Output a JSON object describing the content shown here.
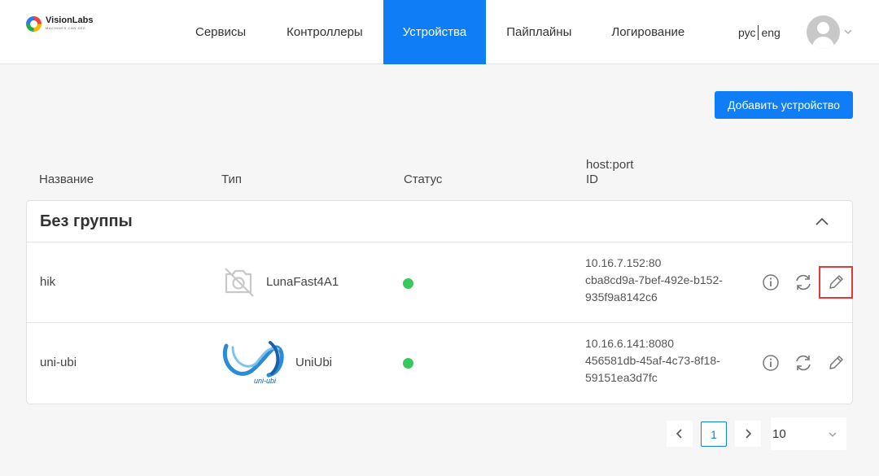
{
  "logo": {
    "name": "VisionLabs",
    "tagline": "MACHINES CAN SEE"
  },
  "nav": {
    "items": [
      {
        "label": "Сервисы"
      },
      {
        "label": "Контроллеры"
      },
      {
        "label": "Устройства",
        "active": true
      },
      {
        "label": "Пайплайны"
      },
      {
        "label": "Логирование"
      }
    ],
    "lang_ru": "рус",
    "lang_en": "eng"
  },
  "toolbar": {
    "add_label": "Добавить устройство"
  },
  "columns": {
    "name": "Название",
    "type": "Тип",
    "status": "Статус",
    "host": "host:port",
    "id": "ID"
  },
  "group": {
    "title": "Без группы"
  },
  "devices": [
    {
      "name": "hik",
      "type": "LunaFast4A1",
      "type_icon": "no-camera-icon",
      "status": "online",
      "status_color": "#3ac85c",
      "host": "10.16.7.152:80",
      "id_line1": "cba8cd9a-7bef-492e-b152-",
      "id_line2": "935f9a8142c6"
    },
    {
      "name": "uni-ubi",
      "type": "UniUbi",
      "type_icon": "uniubi-logo",
      "logo_text": "uni-ubi",
      "status": "online",
      "status_color": "#3ac85c",
      "host": "10.16.6.141:8080",
      "id_line1": "456581db-45af-4c73-8f18-",
      "id_line2": "59151ea3d7fc"
    }
  ],
  "pagination": {
    "current_page": "1",
    "page_size": "10"
  },
  "colors": {
    "accent": "#0f7ef6",
    "status_ok": "#3ac85c",
    "highlight": "#e53935"
  }
}
